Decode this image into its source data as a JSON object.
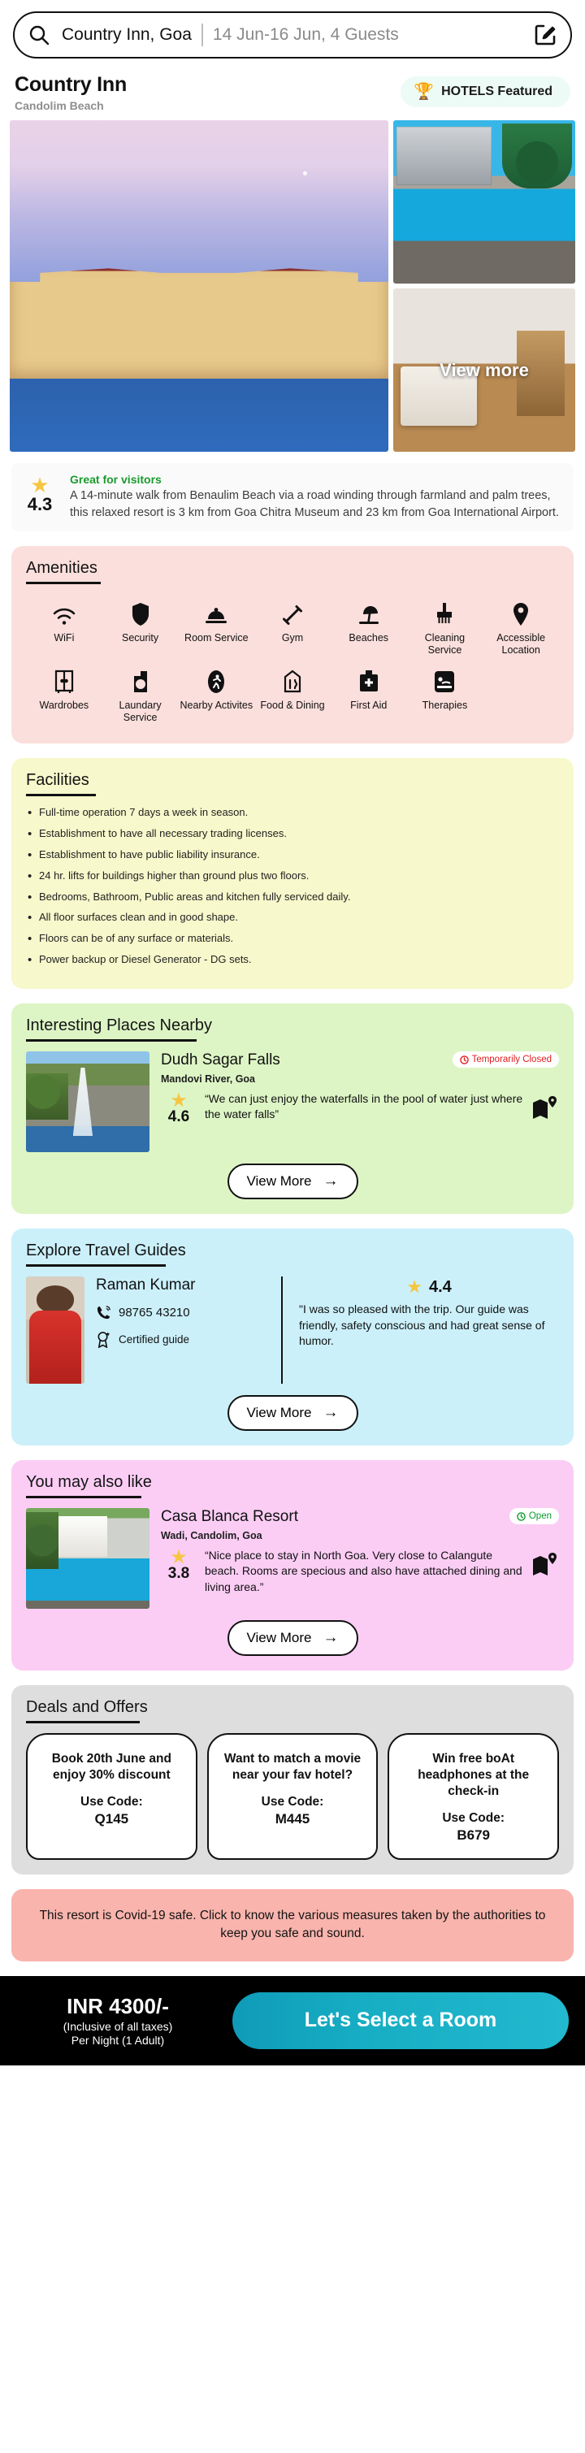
{
  "search": {
    "query": "Country Inn, Goa",
    "meta": "14 Jun-16 Jun, 4 Guests",
    "search_icon": "search-icon",
    "edit_icon": "edit-square-icon"
  },
  "header": {
    "hotel_name": "Country Inn",
    "hotel_location": "Candolim Beach",
    "featured_badge": "HOTELS Featured",
    "trophy_icon": "🏆",
    "badge_bg": "#edfbf7"
  },
  "gallery": {
    "view_more_label": "View more",
    "images": [
      "hotel-exterior-pool-evening",
      "resort-building-poolside",
      "hotel-room-interior"
    ]
  },
  "rating": {
    "score": "4.3",
    "star_icon": "★",
    "title": "Great for visitors",
    "title_color": "#1a9b2e",
    "description": "A 14-minute walk from Benaulim Beach via a road winding through farmland and palm trees, this relaxed resort is 3 km from Goa Chitra Museum and 23 km from Goa International Airport."
  },
  "amenities": {
    "title": "Amenities",
    "bg": "#fbdfdc",
    "items": [
      {
        "label": "WiFi",
        "icon": "wifi-icon"
      },
      {
        "label": "Security",
        "icon": "shield-icon"
      },
      {
        "label": "Room Service",
        "icon": "room-service-icon"
      },
      {
        "label": "Gym",
        "icon": "dumbbell-icon"
      },
      {
        "label": "Beaches",
        "icon": "beach-umbrella-icon"
      },
      {
        "label": "Cleaning Service",
        "icon": "cleaning-brush-icon"
      },
      {
        "label": "Accessible Location",
        "icon": "location-pin-icon"
      },
      {
        "label": "Wardrobes",
        "icon": "wardrobe-icon"
      },
      {
        "label": "Laundary Service",
        "icon": "laundry-icon"
      },
      {
        "label": "Nearby Activites",
        "icon": "running-person-icon"
      },
      {
        "label": "Food & Dining",
        "icon": "restaurant-house-icon"
      },
      {
        "label": "First Aid",
        "icon": "first-aid-kit-icon"
      },
      {
        "label": "Therapies",
        "icon": "massage-icon"
      }
    ]
  },
  "facilities": {
    "title": "Facilities",
    "bg": "#f7f8cb",
    "items": [
      "Full-time operation 7 days a week in season.",
      "Establishment to have all necessary trading licenses.",
      "Establishment to have public liability insurance.",
      "24 hr. lifts for buildings higher than ground plus two floors.",
      "Bedrooms, Bathroom, Public areas and kitchen fully serviced daily.",
      "All floor surfaces clean and in good shape.",
      "Floors can be of any surface or materials.",
      "Power backup or Diesel Generator - DG sets."
    ]
  },
  "places_nearby": {
    "title": "Interesting Places Nearby",
    "bg": "#ddf5c5",
    "name": "Dudh Sagar Falls",
    "location": "Mandovi River, Goa",
    "status": "Temporarily Closed",
    "status_icon": "clock-icon",
    "status_color": "#e11d1d",
    "rating": "4.6",
    "star_icon": "★",
    "quote": "“We can just enjoy the waterfalls in the pool of water just where the water falls”",
    "map_icon": "map-pin-icon",
    "button_label": "View More",
    "button_arrow": "→"
  },
  "travel_guides": {
    "title": "Explore Travel Guides",
    "bg": "#cbf0fa",
    "guide_name": "Raman Kumar",
    "phone": "98765 43210",
    "phone_icon": "phone-ring-icon",
    "certified_label": "Certified guide",
    "certified_icon": "badge-star-icon",
    "rating": "4.4",
    "star_icon": "★",
    "quote": "\"I was so pleased with the trip. Our guide was friendly, safety conscious and had great sense of humor.",
    "button_label": "View More",
    "button_arrow": "→"
  },
  "you_may_also_like": {
    "title": "You may also like",
    "bg": "#fbcdf4",
    "name": "Casa Blanca Resort",
    "location": "Wadi, Candolim, Goa",
    "status": "Open",
    "status_icon": "clock-icon",
    "status_color": "#0b9b2f",
    "rating": "3.8",
    "star_icon": "★",
    "quote": "“Nice place to stay in North Goa. Very close to Calangute beach. Rooms are specious and also have attached dining and living area.”",
    "map_icon": "map-pin-icon",
    "button_label": "View More",
    "button_arrow": "→"
  },
  "deals": {
    "title": "Deals and Offers",
    "bg": "#dedede",
    "code_label": "Use Code:",
    "items": [
      {
        "text": "Book 20th June and enjoy 30% discount",
        "code": "Q145"
      },
      {
        "text": "Want to match a movie near your fav hotel?",
        "code": "M445"
      },
      {
        "text": "Win free boAt headphones at the check-in",
        "code": "B679"
      }
    ]
  },
  "covid": {
    "bg": "#f9b4ad",
    "text": "This resort is Covid-19 safe. Click to know the various measures taken by the authorities to keep you safe and sound."
  },
  "bottom_bar": {
    "bg": "#000000",
    "price": "INR 4300/-",
    "price_note_1": "(Inclusive of all taxes)",
    "price_note_2": "Per Night (1 Adult)",
    "cta_label": "Let's Select a Room",
    "cta_color": "#17aec4"
  }
}
